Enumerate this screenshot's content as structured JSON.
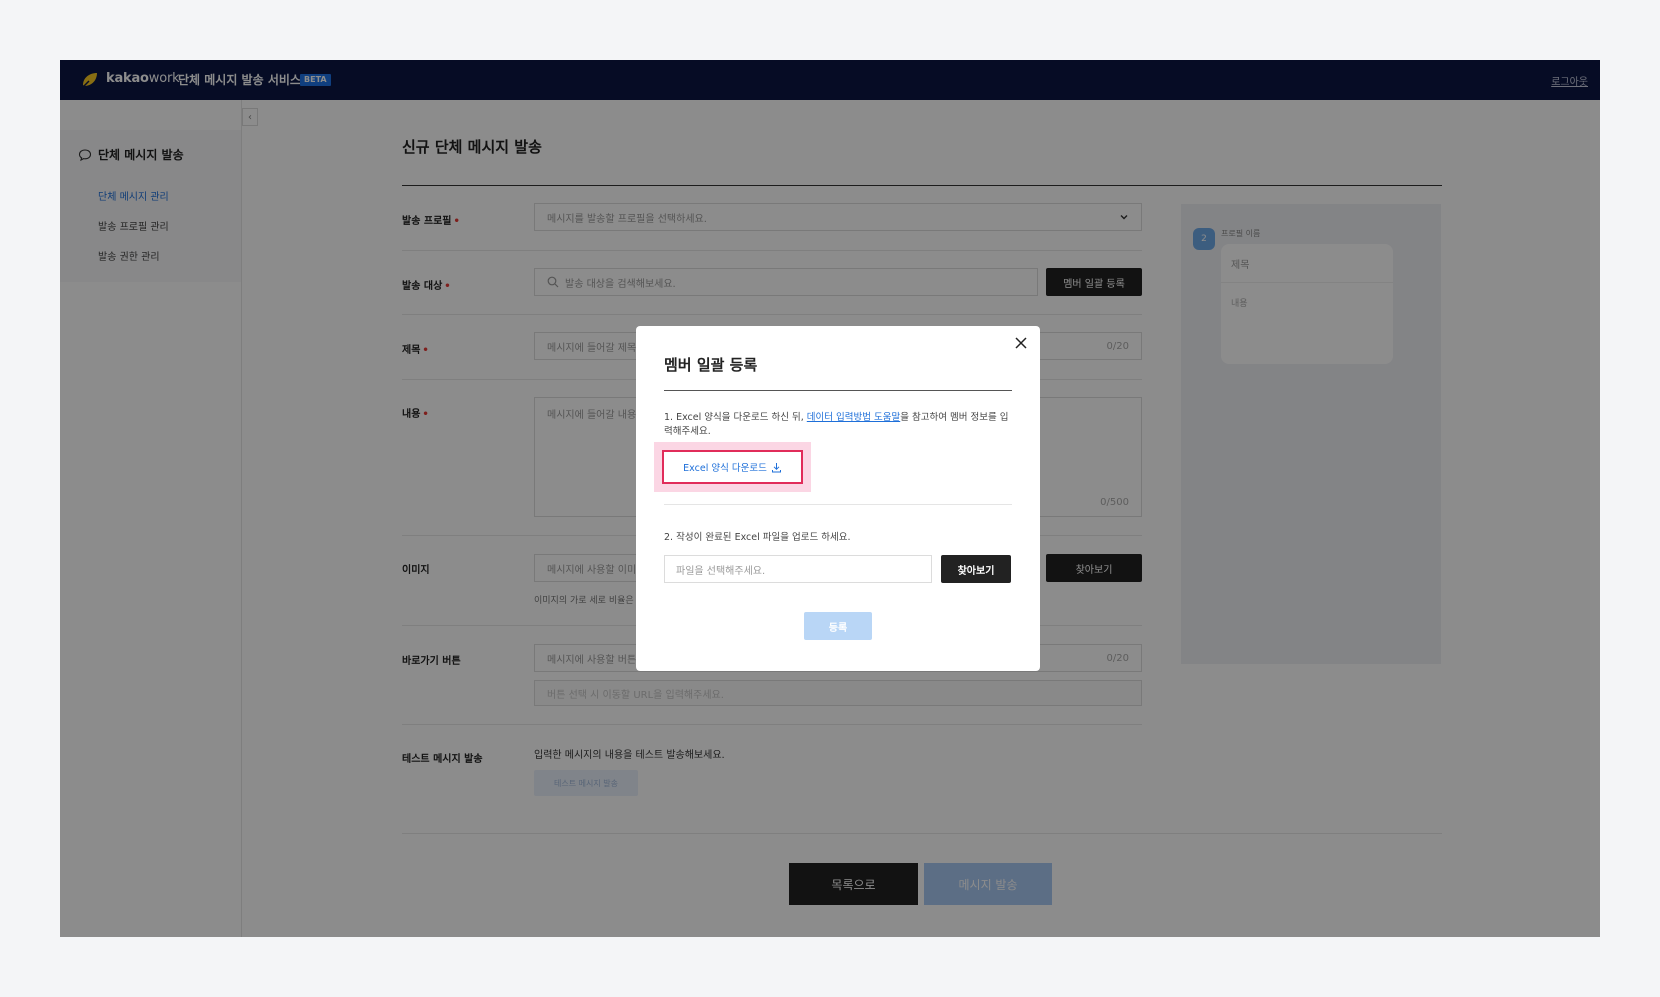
{
  "header": {
    "logo_bold": "kakao",
    "logo_light": "work",
    "service_name": "단체 메시지 발송 서비스",
    "beta": "BETA",
    "logout": "로그아웃"
  },
  "sidebar": {
    "title": "단체 메시지 발송",
    "collapse": "‹",
    "items": [
      {
        "label": "단체 메시지 관리",
        "active": true
      },
      {
        "label": "발송 프로필 관리",
        "active": false
      },
      {
        "label": "발송 권한 관리",
        "active": false
      }
    ]
  },
  "page": {
    "title": "신규 단체 메시지 발송",
    "req": "•",
    "profile": {
      "label": "발송 프로필",
      "placeholder": "메시지를 발송할 프로필을 선택하세요."
    },
    "target": {
      "label": "발송 대상",
      "placeholder": "발송 대상을 검색해보세요.",
      "button": "멤버 일괄 등록"
    },
    "subject": {
      "label": "제목",
      "placeholder": "메시지에 들어갈 제목을",
      "counter": "0/20"
    },
    "content": {
      "label": "내용",
      "placeholder": "메시지에 들어갈 내용을",
      "counter": "0/500"
    },
    "image": {
      "label": "이미지",
      "placeholder": "메시지에 사용할 이미지",
      "button": "찾아보기",
      "hint": "이미지의 가로 세로 비율은"
    },
    "shortcut": {
      "label": "바로가기 버튼",
      "placeholder": "메시지에 사용할 버튼",
      "counter": "0/20",
      "url_placeholder": "버튼 선택 시 이동할 URL을 입력해주세요."
    },
    "test": {
      "label": "테스트 메시지 발송",
      "desc": "입력한 메시지의 내용을 테스트 발송해보세요.",
      "button": "테스트 메시지 발송"
    },
    "back_button": "목록으로",
    "send_button": "메시지 발송"
  },
  "preview": {
    "avatar": "2",
    "profile_name": "프로필 이름",
    "card_title": "제목",
    "card_content": "내용"
  },
  "modal": {
    "title": "멤버 일괄 등록",
    "step1_before": "1. Excel 양식을 다운로드 하신 뒤, ",
    "step1_link": "데이터 입력방법 도움말",
    "step1_after": "을 참고하여 멤버 정보를 입력해주세요.",
    "download_button": "Excel 양식 다운로드",
    "step2": "2. 작성이 완료된 Excel 파일을 업로드 하세요.",
    "file_placeholder": "파일을 선택해주세요.",
    "browse_button": "찾아보기",
    "register_button": "등록"
  },
  "colors": {
    "header_bg": "#0b1744",
    "accent": "#1e6fd9",
    "highlight": "#e12c5a"
  }
}
